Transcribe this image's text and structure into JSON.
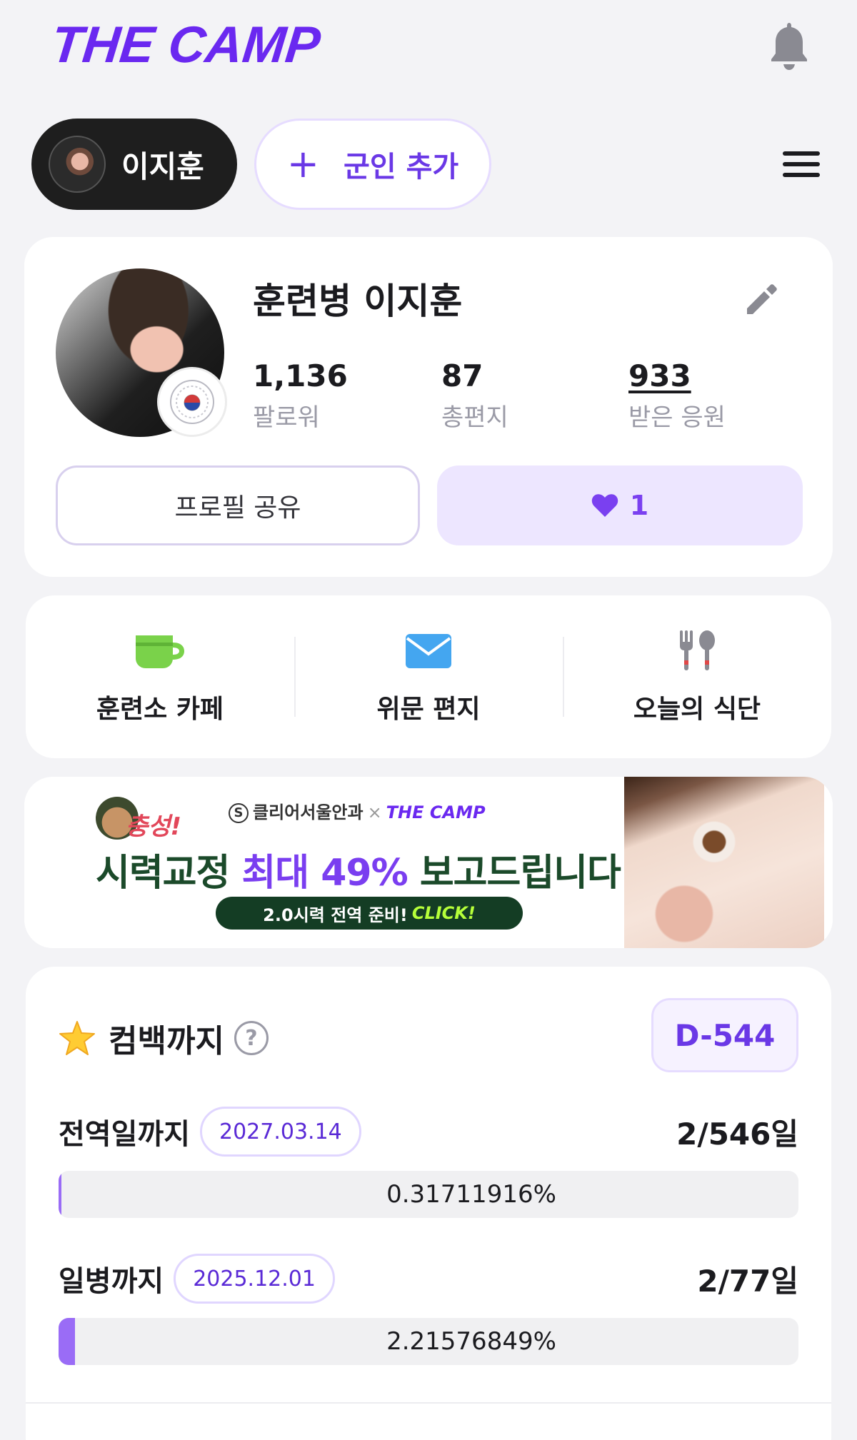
{
  "header": {
    "logo": "THE CAMP"
  },
  "tabs": {
    "active_soldier": "이지훈",
    "add_label": "군인 추가",
    "add_symbol": "+"
  },
  "profile": {
    "name": "훈련병 이지훈",
    "stats": [
      {
        "value": "1,136",
        "label": "팔로워"
      },
      {
        "value": "87",
        "label": "총편지"
      },
      {
        "value": "933",
        "label": "받은 응원"
      }
    ],
    "share_label": "프로필 공유",
    "like_count": "1"
  },
  "quick_menu": [
    {
      "label": "훈련소 카페",
      "icon": "cup-icon"
    },
    {
      "label": "위문 편지",
      "icon": "envelope-icon"
    },
    {
      "label": "오늘의 식단",
      "icon": "utensils-icon"
    }
  ],
  "banner": {
    "cheer": "충성!",
    "brand": "클리어서울안과",
    "separator": "×",
    "partner": "THE CAMP",
    "headline_pre": "시력교정 ",
    "headline_highlight": "최대 49%",
    "headline_post": " 보고드립니다!",
    "sub_text": "2.0시력 전역 준비!",
    "sub_click": "CLICK!"
  },
  "comeback": {
    "title": "컴백까지",
    "help_symbol": "?",
    "dday": "D-544",
    "rows": [
      {
        "label": "전역일까지",
        "date": "2027.03.14",
        "count": "2/546일",
        "percent_text": "0.31711916%",
        "percent": 0.31711916
      },
      {
        "label": "일병까지",
        "date": "2025.12.01",
        "count": "2/77일",
        "percent_text": "2.21576849%",
        "percent": 2.21576849
      }
    ]
  },
  "colors": {
    "brand_purple": "#6a28f0",
    "accent_purple": "#7a40f0",
    "progress_fill": "#9a6cf6",
    "page_bg": "#f3f3f6"
  }
}
